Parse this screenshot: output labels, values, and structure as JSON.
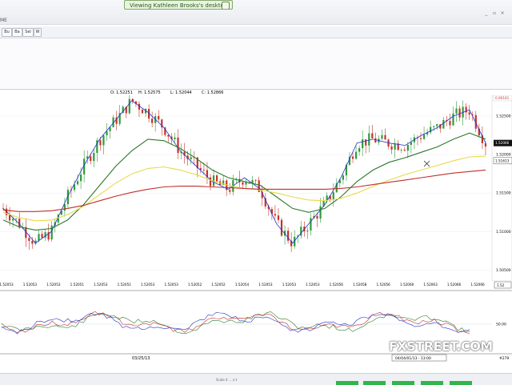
{
  "window": {
    "share_banner": "Viewing Kathleen Brooks's desktop"
  },
  "toolbar": {
    "left_label": "ME",
    "buttons": [
      "Bu",
      "Ba",
      "Sel",
      "W"
    ]
  },
  "ohlc": {
    "open": "O: 1.52251",
    "high": "H: 1.52575",
    "low": "L: 1.52044",
    "close": "C: 1.52866"
  },
  "price_axis": {
    "top_badge": "0.00161",
    "labels": [
      "1.52500",
      "1.52000",
      "1.51500",
      "1.51000",
      "1.50500"
    ],
    "current_label": "1.52066",
    "second_label": "1.51613"
  },
  "time_axis": {
    "labels": [
      "1.52053",
      "1.52053",
      "1.52053",
      "1.52051",
      "1.52053",
      "1.52051",
      "1.52053",
      "1.52053",
      "1.52052",
      "1.52052",
      "1.52054",
      "1.52053",
      "1.52053",
      "1.52053",
      "1.52056",
      "1.52058",
      "1.52056",
      "1.52060",
      "1.52063",
      "1.52066",
      "1.52066"
    ],
    "right_box": "1.52"
  },
  "oscillator": {
    "level_label": "50.00"
  },
  "date_axis": {
    "left_date": "03/25/13",
    "right_label": "04/04/01/13 - 13:00",
    "right_num": "#279"
  },
  "bottom": {
    "status": "Scale 4 ... n.t"
  },
  "watermark": "FXSTREET.COM",
  "chart_data": {
    "type": "line",
    "series": [
      {
        "values": [
          1.513,
          1.511,
          1.5085,
          1.51,
          1.5145,
          1.5185,
          1.522,
          1.5245,
          1.527,
          1.5255,
          1.5235,
          1.5205,
          1.5185,
          1.5165,
          1.5155,
          1.517,
          1.5155,
          1.511,
          1.5085,
          1.511,
          1.5135,
          1.517,
          1.5215,
          1.522,
          1.5215,
          1.5212,
          1.5225,
          1.5235,
          1.525,
          1.5258,
          1.5215
        ]
      },
      {
        "values": [
          1.5115,
          1.5106,
          1.5102,
          1.5104,
          1.5115,
          1.5135,
          1.516,
          1.5185,
          1.5205,
          1.522,
          1.5218,
          1.5208,
          1.5195,
          1.518,
          1.517,
          1.5165,
          1.516,
          1.5145,
          1.513,
          1.5125,
          1.513,
          1.5145,
          1.5165,
          1.518,
          1.519,
          1.5196,
          1.5203,
          1.521,
          1.522,
          1.5228,
          1.522
        ]
      },
      {
        "values": [
          1.5125,
          1.5118,
          1.5114,
          1.5115,
          1.5122,
          1.5133,
          1.5148,
          1.5163,
          1.5175,
          1.5182,
          1.5184,
          1.518,
          1.5174,
          1.5166,
          1.516,
          1.5156,
          1.5154,
          1.515,
          1.5145,
          1.5141,
          1.514,
          1.5143,
          1.515,
          1.5159,
          1.5167,
          1.5174,
          1.518,
          1.5186,
          1.5192,
          1.5197,
          1.5198
        ]
      },
      {
        "values": [
          1.5128,
          1.5126,
          1.5126,
          1.5127,
          1.513,
          1.5134,
          1.514,
          1.5146,
          1.5151,
          1.5155,
          1.5158,
          1.5159,
          1.5159,
          1.5158,
          1.5157,
          1.5156,
          1.5155,
          1.5155,
          1.5155,
          1.5155,
          1.5155,
          1.5156,
          1.5158,
          1.5161,
          1.5164,
          1.5167,
          1.517,
          1.5173,
          1.5176,
          1.5178,
          1.518
        ]
      }
    ],
    "colors": [
      "#2233cc",
      "#2a7a2a",
      "#e8d84a",
      "#c0302a"
    ],
    "candle_colors": {
      "up": "#2f9a3a",
      "down": "#c63228"
    },
    "ylim": [
      1.504,
      1.5275
    ],
    "grid": true
  }
}
